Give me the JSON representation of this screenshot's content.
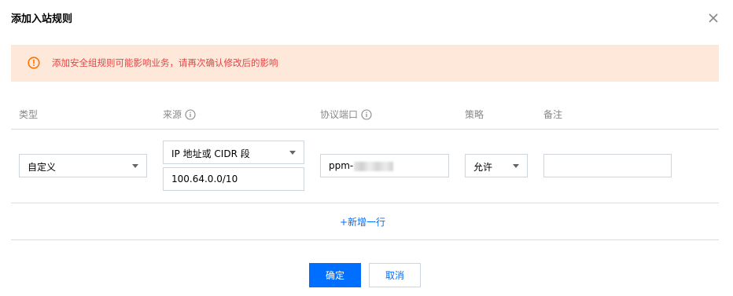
{
  "dialog": {
    "title": "添加入站规则",
    "close_icon": "close-icon"
  },
  "alert": {
    "icon": "warning-circle-icon",
    "text": "添加安全组规则可能影响业务，请再次确认修改后的影响",
    "color": "#e54545",
    "background": "#fde8da"
  },
  "table": {
    "headers": {
      "type": "类型",
      "source": "来源",
      "protocol_port": "协议端口",
      "policy": "策略",
      "note": "备注"
    },
    "row": {
      "type_value": "自定义",
      "source_type_value": "IP 地址或 CIDR 段",
      "source_value": "100.64.0.0/10",
      "protocol_port_value": "ppm-",
      "policy_value": "允许",
      "note_value": ""
    }
  },
  "add_row_label": "+新增一行",
  "buttons": {
    "confirm": "确定",
    "cancel": "取消"
  },
  "colors": {
    "accent": "#006eff",
    "header_text": "#888888",
    "border": "#cfd5de"
  }
}
